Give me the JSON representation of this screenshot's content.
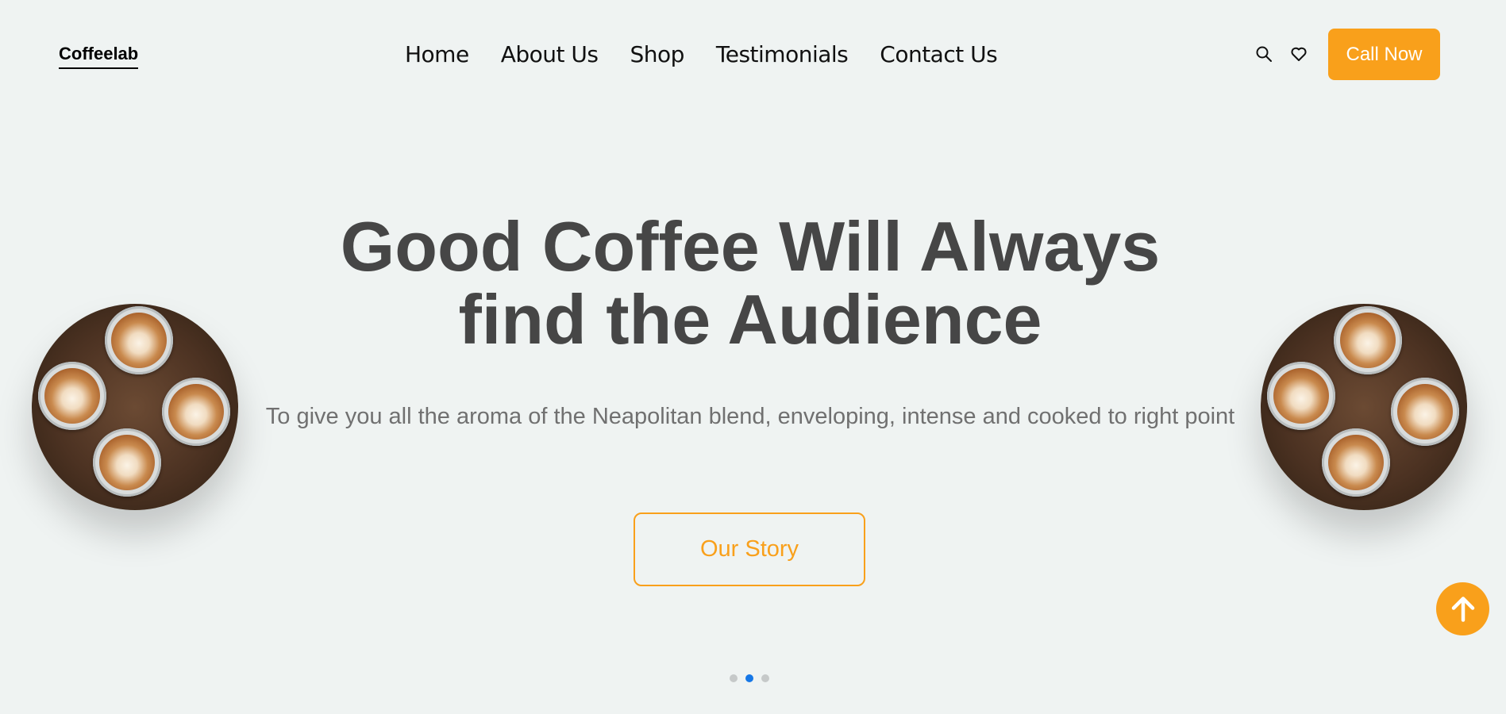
{
  "brand": {
    "logo": "Coffeelab"
  },
  "nav": {
    "items": [
      {
        "label": "Home"
      },
      {
        "label": "About Us"
      },
      {
        "label": "Shop"
      },
      {
        "label": "Testimonials"
      },
      {
        "label": "Contact Us"
      }
    ]
  },
  "header_actions": {
    "search_icon": "search-icon",
    "wishlist_icon": "heart-icon",
    "call_label": "Call Now"
  },
  "hero": {
    "title_line1": "Good Coffee Will Always",
    "title_line2": "find the Audience",
    "subtitle": "To give you all the aroma of the Neapolitan blend, enveloping, intense and cooked to right point",
    "cta_label": "Our Story"
  },
  "carousel": {
    "slide_count": 3,
    "active_index": 1
  },
  "colors": {
    "accent": "#f9a01b",
    "background": "#eff3f2",
    "title": "#464646",
    "subtitle": "#707070",
    "dot_active": "#1677e6"
  }
}
